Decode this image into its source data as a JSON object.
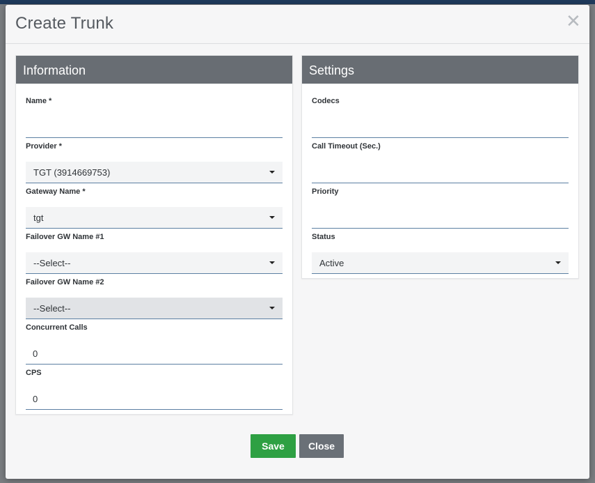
{
  "modal": {
    "title": "Create Trunk",
    "close_glyph": "✕"
  },
  "information": {
    "heading": "Information",
    "name": {
      "label": "Name *",
      "value": ""
    },
    "provider": {
      "label": "Provider *",
      "value": "TGT (3914669753)"
    },
    "gateway_name": {
      "label": "Gateway Name *",
      "value": "tgt"
    },
    "failover1": {
      "label": "Failover GW Name #1",
      "value": "--Select--"
    },
    "failover2": {
      "label": "Failover GW Name #2",
      "value": "--Select--"
    },
    "concurrent_calls": {
      "label": "Concurrent Calls",
      "value": "0"
    },
    "cps": {
      "label": "CPS",
      "value": "0"
    }
  },
  "settings": {
    "heading": "Settings",
    "codecs": {
      "label": "Codecs",
      "value": ""
    },
    "call_timeout": {
      "label": "Call Timeout (Sec.)",
      "value": ""
    },
    "priority": {
      "label": "Priority",
      "value": ""
    },
    "status": {
      "label": "Status",
      "value": "Active"
    }
  },
  "footer": {
    "save_label": "Save",
    "close_label": "Close"
  },
  "colors": {
    "panel_header": "#686d73",
    "save_button": "#2ea043",
    "close_button": "#6a7077",
    "input_underline": "#5b7fa2"
  }
}
